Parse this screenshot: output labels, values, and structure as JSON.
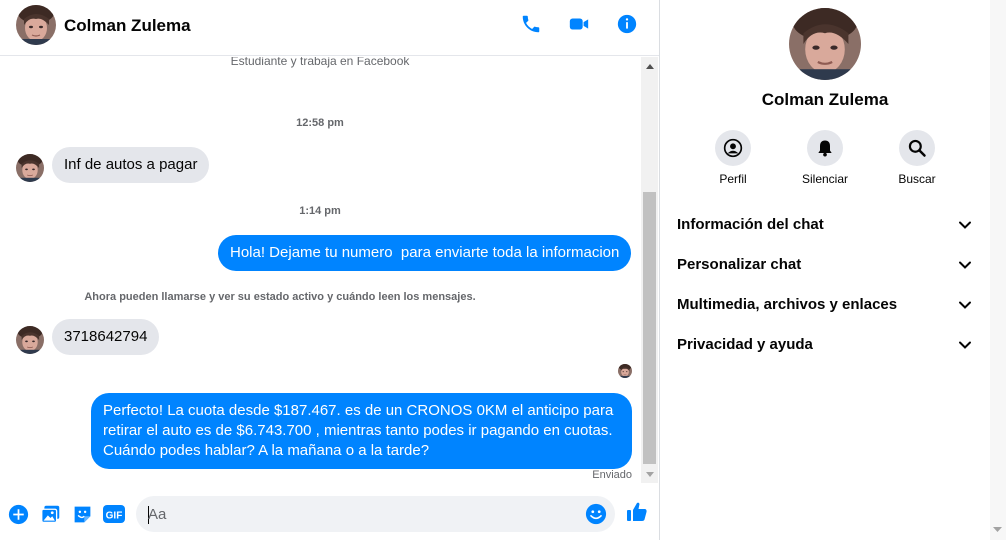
{
  "contact": {
    "name": "Colman Zulema"
  },
  "messages": {
    "intro_text": "Estudiante y trabaja en Facebook",
    "time_1": "12:58 pm",
    "incoming_1": "Inf de autos a pagar",
    "time_2": "1:14 pm",
    "outgoing_1": "Hola! Dejame tu numero  para enviarte toda la informacion",
    "system_notice": "Ahora pueden llamarse y ver su estado activo y cuándo leen los mensajes.",
    "incoming_2": "3718642794",
    "outgoing_2_line1": "Perfecto! La cuota desde $187.467. es de un CRONOS 0KM el anticipo para",
    "outgoing_2_line2": "retirar el auto es de $6.743.700 , mientras tanto podes ir pagando en cuotas.",
    "outgoing_2_line3": "Cuándo podes hablar? A la mañana o a la tarde?",
    "status": "Enviado"
  },
  "composer": {
    "placeholder": "Aa",
    "gif_label": "GIF"
  },
  "info_panel": {
    "actions": [
      {
        "label": "Perfil",
        "icon": "profile-icon"
      },
      {
        "label": "Silenciar",
        "icon": "bell-icon"
      },
      {
        "label": "Buscar",
        "icon": "search-icon"
      }
    ],
    "sections": [
      {
        "label": "Información del chat"
      },
      {
        "label": "Personalizar chat"
      },
      {
        "label": "Multimedia, archivos y enlaces"
      },
      {
        "label": "Privacidad y ayuda"
      }
    ]
  },
  "colors": {
    "accent": "#0084ff",
    "bubble_in": "#e4e6eb",
    "muted_text": "#65676b"
  }
}
